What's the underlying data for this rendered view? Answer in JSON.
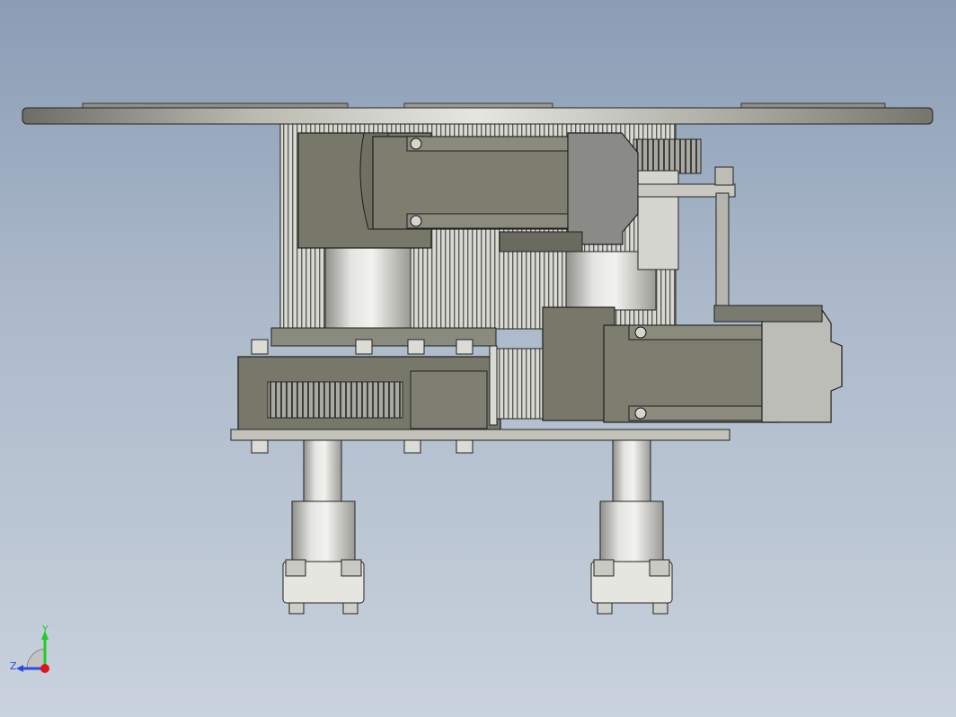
{
  "viewport": {
    "background_top": "#8a9db5",
    "background_bottom": "#c9d2dd"
  },
  "model": {
    "part_color_dark": "#77786a",
    "part_color_steel": "#c9c9c4",
    "edge_color": "#1e1e1e"
  },
  "triad": {
    "y_label": "Y",
    "z_label": "Z",
    "y_color": "#1fcc2a",
    "z_color": "#2a4bdc",
    "x_color": "#e0141e"
  }
}
